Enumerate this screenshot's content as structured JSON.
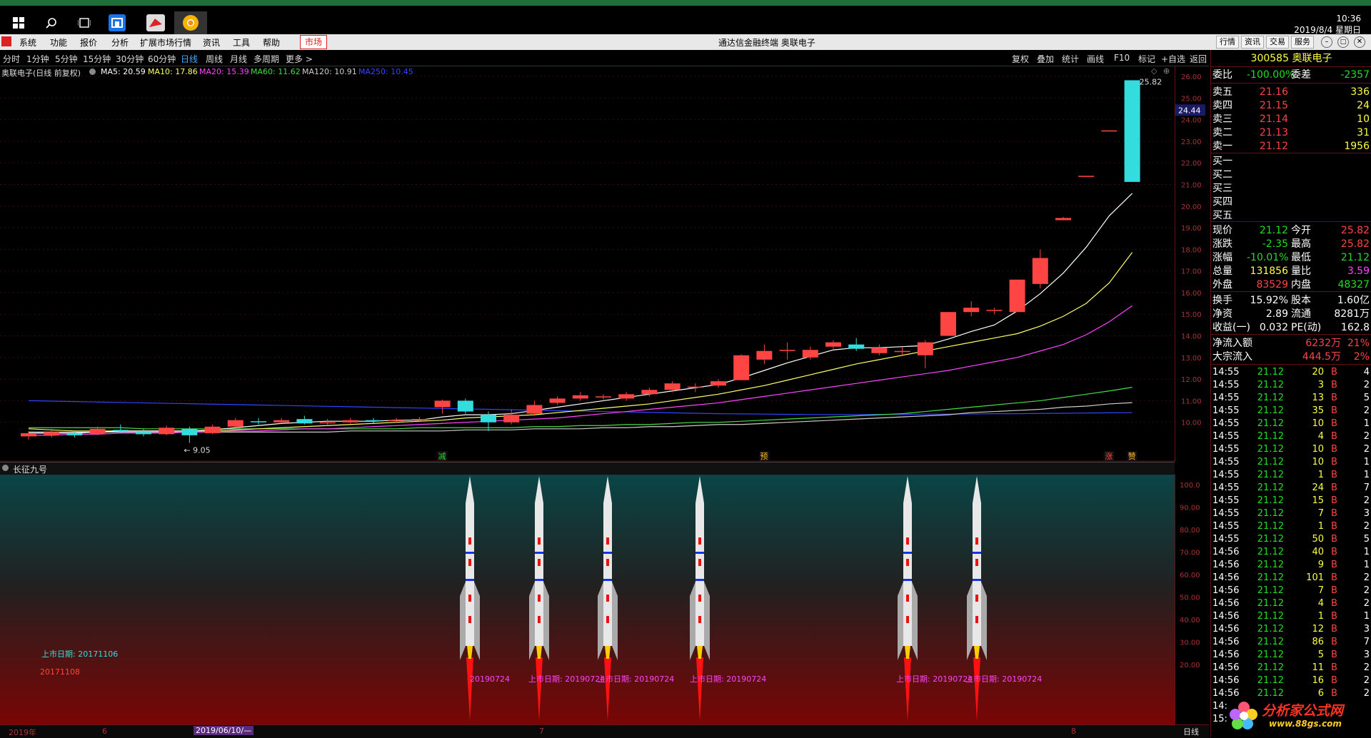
{
  "taskbar": {
    "time": "10:36",
    "date": "2019/8/4 星期日"
  },
  "window": {
    "title": "通达信金融终端 奥联电子",
    "menu": [
      "系统",
      "功能",
      "报价",
      "分析",
      "扩展市场行情",
      "资讯",
      "工具",
      "帮助"
    ],
    "market_tab": "市场",
    "right_buttons": [
      "行情",
      "资讯",
      "交易",
      "服务"
    ]
  },
  "toolbar": {
    "periods": [
      "分时",
      "1分钟",
      "5分钟",
      "15分钟",
      "30分钟",
      "60分钟",
      "日线",
      "周线",
      "月线",
      "多周期",
      "更多 >"
    ],
    "active_period": "日线",
    "tools": [
      "复权",
      "叠加",
      "统计",
      "画线",
      "F10",
      "标记",
      "+自选",
      "返回"
    ]
  },
  "chart_header": {
    "name": "奥联电子(日线 前复权)",
    "ma5": "MA5: 20.59",
    "ma10": "MA10: 17.86",
    "ma20": "MA20: 15.39",
    "ma60": "MA60: 11.62",
    "ma120": "MA120: 10.91",
    "ma250": "MA250: 10.45"
  },
  "colors": {
    "up": "#ff4444",
    "down": "#33dddd",
    "ma5": "#ffffff",
    "ma10": "#ffff66",
    "ma20": "#ff44ff",
    "ma60": "#44dd44",
    "ma120": "#cccccc",
    "ma250": "#3344ff"
  },
  "main_axis_labels": [
    "26.00",
    "25.00",
    "24.00",
    "23.00",
    "22.00",
    "21.00",
    "20.00",
    "19.00",
    "18.00",
    "17.00",
    "16.00",
    "15.00",
    "14.00",
    "13.00",
    "12.00",
    "11.00",
    "10.00"
  ],
  "price_marker": "24.44",
  "annotations": {
    "low_label": "9.05",
    "high_label": "25.82",
    "signals": [
      "减",
      "预",
      "涨",
      "赞"
    ]
  },
  "indicator": {
    "name": "长征九号",
    "axis_labels": [
      "100.0",
      "90.00",
      "80.00",
      "70.00",
      "60.00",
      "50.00",
      "40.00",
      "30.00",
      "20.00"
    ],
    "listing_label": "上市日期: 20171106",
    "listing_date": "20171108",
    "rocket_labels": [
      "20190724",
      "上市日期: 20190724",
      "上市日期: 20190724",
      "上市日期: 20190724",
      "上市日期: 20190724",
      "上市日期: 20190724"
    ]
  },
  "bottom_axis": {
    "year": "2019年",
    "m6": "6",
    "date_box": "2019/06/10/—",
    "m7": "7",
    "m8": "8",
    "period": "日线"
  },
  "chart_data": {
    "type": "candlestick",
    "title": "奥联电子(日线 前复权)",
    "ylim": [
      9,
      26
    ],
    "candles": [
      {
        "o": 9.35,
        "c": 9.5,
        "h": 9.6,
        "l": 9.2
      },
      {
        "o": 9.4,
        "c": 9.55,
        "h": 9.7,
        "l": 9.3
      },
      {
        "o": 9.5,
        "c": 9.4,
        "h": 9.6,
        "l": 9.3
      },
      {
        "o": 9.45,
        "c": 9.7,
        "h": 9.8,
        "l": 9.4
      },
      {
        "o": 9.65,
        "c": 9.6,
        "h": 9.9,
        "l": 9.5
      },
      {
        "o": 9.55,
        "c": 9.45,
        "h": 9.7,
        "l": 9.35
      },
      {
        "o": 9.45,
        "c": 9.75,
        "h": 9.85,
        "l": 9.4
      },
      {
        "o": 9.7,
        "c": 9.4,
        "h": 9.8,
        "l": 9.05
      },
      {
        "o": 9.5,
        "c": 9.8,
        "h": 9.9,
        "l": 9.45
      },
      {
        "o": 9.8,
        "c": 10.1,
        "h": 10.2,
        "l": 9.75
      },
      {
        "o": 10.05,
        "c": 10.0,
        "h": 10.2,
        "l": 9.9
      },
      {
        "o": 10.0,
        "c": 10.1,
        "h": 10.2,
        "l": 9.95
      },
      {
        "o": 10.15,
        "c": 9.95,
        "h": 10.3,
        "l": 9.9
      },
      {
        "o": 10.0,
        "c": 10.0,
        "h": 10.15,
        "l": 9.9
      },
      {
        "o": 10.0,
        "c": 10.1,
        "h": 10.2,
        "l": 9.95
      },
      {
        "o": 10.1,
        "c": 10.05,
        "h": 10.2,
        "l": 9.95
      },
      {
        "o": 10.05,
        "c": 10.1,
        "h": 10.2,
        "l": 10.0
      },
      {
        "o": 10.1,
        "c": 10.15,
        "h": 10.25,
        "l": 10.05
      },
      {
        "o": 10.7,
        "c": 11.0,
        "h": 11.05,
        "l": 10.4
      },
      {
        "o": 11.0,
        "c": 10.5,
        "h": 11.1,
        "l": 10.4
      },
      {
        "o": 10.35,
        "c": 10.0,
        "h": 10.5,
        "l": 9.6
      },
      {
        "o": 10.0,
        "c": 10.35,
        "h": 10.6,
        "l": 9.9
      },
      {
        "o": 10.4,
        "c": 10.8,
        "h": 11.0,
        "l": 10.3
      },
      {
        "o": 10.9,
        "c": 11.1,
        "h": 11.2,
        "l": 10.8
      },
      {
        "o": 11.1,
        "c": 11.25,
        "h": 11.4,
        "l": 11.0
      },
      {
        "o": 11.2,
        "c": 11.2,
        "h": 11.3,
        "l": 11.05
      },
      {
        "o": 11.1,
        "c": 11.3,
        "h": 11.4,
        "l": 11.0
      },
      {
        "o": 11.3,
        "c": 11.5,
        "h": 11.6,
        "l": 11.2
      },
      {
        "o": 11.5,
        "c": 11.8,
        "h": 11.9,
        "l": 11.4
      },
      {
        "o": 11.65,
        "c": 11.65,
        "h": 11.8,
        "l": 11.4
      },
      {
        "o": 11.7,
        "c": 11.9,
        "h": 12.0,
        "l": 11.6
      },
      {
        "o": 11.95,
        "c": 13.1,
        "h": 13.15,
        "l": 11.95
      },
      {
        "o": 12.9,
        "c": 13.3,
        "h": 13.6,
        "l": 12.7
      },
      {
        "o": 13.3,
        "c": 13.35,
        "h": 13.7,
        "l": 12.9
      },
      {
        "o": 13.0,
        "c": 13.35,
        "h": 13.5,
        "l": 12.9
      },
      {
        "o": 13.5,
        "c": 13.7,
        "h": 13.8,
        "l": 13.4
      },
      {
        "o": 13.6,
        "c": 13.4,
        "h": 13.9,
        "l": 13.3
      },
      {
        "o": 13.2,
        "c": 13.45,
        "h": 13.6,
        "l": 13.1
      },
      {
        "o": 13.3,
        "c": 13.3,
        "h": 13.5,
        "l": 13.1
      },
      {
        "o": 13.1,
        "c": 13.7,
        "h": 13.8,
        "l": 12.5
      },
      {
        "o": 14.0,
        "c": 15.1,
        "h": 15.1,
        "l": 14.0
      },
      {
        "o": 15.1,
        "c": 15.3,
        "h": 15.6,
        "l": 14.9
      },
      {
        "o": 15.2,
        "c": 15.2,
        "h": 15.3,
        "l": 15.0
      },
      {
        "o": 15.1,
        "c": 16.6,
        "h": 16.6,
        "l": 15.1
      },
      {
        "o": 16.4,
        "c": 17.6,
        "h": 18.0,
        "l": 16.2
      },
      {
        "o": 19.35,
        "c": 19.45,
        "h": 19.5,
        "l": 19.35
      },
      {
        "o": 21.4,
        "c": 21.4,
        "h": 21.4,
        "l": 21.4
      },
      {
        "o": 23.5,
        "c": 23.5,
        "h": 23.5,
        "l": 23.5
      },
      {
        "o": 25.82,
        "c": 21.12,
        "h": 25.82,
        "l": 21.12
      }
    ],
    "ma5": [
      9.5,
      9.5,
      9.5,
      9.55,
      9.6,
      9.6,
      9.6,
      9.6,
      9.65,
      9.75,
      9.85,
      9.95,
      10.0,
      10.05,
      10.05,
      10.05,
      10.1,
      10.1,
      10.25,
      10.35,
      10.35,
      10.4,
      10.55,
      10.7,
      10.85,
      11.0,
      11.15,
      11.3,
      11.45,
      11.6,
      11.75,
      12.05,
      12.4,
      12.75,
      13.05,
      13.35,
      13.45,
      13.45,
      13.5,
      13.55,
      13.85,
      14.2,
      14.5,
      15.15,
      15.95,
      16.9,
      18.1,
      19.55,
      20.59
    ],
    "ma10": [
      9.7,
      9.65,
      9.6,
      9.6,
      9.6,
      9.6,
      9.6,
      9.6,
      9.6,
      9.65,
      9.7,
      9.75,
      9.8,
      9.85,
      9.9,
      9.95,
      10.0,
      10.05,
      10.1,
      10.2,
      10.25,
      10.3,
      10.35,
      10.45,
      10.55,
      10.65,
      10.75,
      10.85,
      11.0,
      11.15,
      11.3,
      11.5,
      11.7,
      11.95,
      12.2,
      12.45,
      12.7,
      12.9,
      13.1,
      13.3,
      13.5,
      13.7,
      13.9,
      14.1,
      14.45,
      14.9,
      15.5,
      16.45,
      17.86
    ],
    "ma20": [
      9.4,
      9.4,
      9.45,
      9.45,
      9.5,
      9.5,
      9.5,
      9.55,
      9.55,
      9.6,
      9.6,
      9.65,
      9.7,
      9.7,
      9.75,
      9.8,
      9.85,
      9.9,
      9.95,
      10.0,
      10.05,
      10.1,
      10.15,
      10.2,
      10.3,
      10.4,
      10.5,
      10.6,
      10.7,
      10.8,
      10.9,
      11.05,
      11.2,
      11.35,
      11.5,
      11.65,
      11.8,
      11.95,
      12.1,
      12.25,
      12.4,
      12.6,
      12.8,
      13.0,
      13.3,
      13.6,
      14.05,
      14.65,
      15.39
    ],
    "ma60": [
      9.75,
      9.75,
      9.75,
      9.75,
      9.75,
      9.7,
      9.7,
      9.7,
      9.7,
      9.7,
      9.7,
      9.7,
      9.7,
      9.7,
      9.7,
      9.7,
      9.7,
      9.75,
      9.75,
      9.75,
      9.75,
      9.75,
      9.8,
      9.8,
      9.85,
      9.85,
      9.9,
      9.9,
      9.95,
      10.0,
      10.0,
      10.05,
      10.1,
      10.15,
      10.2,
      10.25,
      10.3,
      10.35,
      10.4,
      10.5,
      10.6,
      10.7,
      10.8,
      10.9,
      11.0,
      11.15,
      11.3,
      11.45,
      11.62
    ],
    "ma120": [
      9.55,
      9.55,
      9.55,
      9.55,
      9.55,
      9.55,
      9.55,
      9.55,
      9.55,
      9.55,
      9.55,
      9.55,
      9.55,
      9.55,
      9.6,
      9.6,
      9.6,
      9.6,
      9.6,
      9.65,
      9.65,
      9.65,
      9.7,
      9.7,
      9.7,
      9.75,
      9.75,
      9.8,
      9.8,
      9.85,
      9.9,
      9.9,
      9.95,
      10.0,
      10.05,
      10.1,
      10.15,
      10.2,
      10.25,
      10.3,
      10.35,
      10.45,
      10.5,
      10.55,
      10.6,
      10.7,
      10.75,
      10.85,
      10.91
    ],
    "ma250": [
      11.0,
      10.98,
      10.96,
      10.94,
      10.92,
      10.9,
      10.88,
      10.86,
      10.84,
      10.82,
      10.8,
      10.78,
      10.76,
      10.74,
      10.72,
      10.7,
      10.68,
      10.66,
      10.64,
      10.62,
      10.6,
      10.58,
      10.56,
      10.54,
      10.52,
      10.5,
      10.48,
      10.46,
      10.44,
      10.42,
      10.4,
      10.39,
      10.38,
      10.37,
      10.36,
      10.36,
      10.36,
      10.37,
      10.37,
      10.38,
      10.38,
      10.39,
      10.4,
      10.4,
      10.41,
      10.42,
      10.43,
      10.44,
      10.45
    ],
    "rocket_candle_index": [
      20,
      23,
      26,
      30,
      39,
      42
    ]
  },
  "quote": {
    "code_name": "300585 奥联电子",
    "weibi_label": "委比",
    "weibi": "-100.00%",
    "weicha_label": "委差",
    "weicha": "-2357",
    "sells": [
      {
        "label": "卖五",
        "price": "21.16",
        "vol": "336"
      },
      {
        "label": "卖四",
        "price": "21.15",
        "vol": "24"
      },
      {
        "label": "卖三",
        "price": "21.14",
        "vol": "10"
      },
      {
        "label": "卖二",
        "price": "21.13",
        "vol": "31"
      },
      {
        "label": "卖一",
        "price": "21.12",
        "vol": "1956"
      }
    ],
    "buys": [
      "买一",
      "买二",
      "买三",
      "买四",
      "买五"
    ],
    "stats": [
      {
        "l1": "现价",
        "v1": "21.12",
        "l2": "今开",
        "v2": "25.82",
        "c1": "grn",
        "c2": "red"
      },
      {
        "l1": "涨跌",
        "v1": "-2.35",
        "l2": "最高",
        "v2": "25.82",
        "c1": "grn",
        "c2": "red"
      },
      {
        "l1": "涨幅",
        "v1": "-10.01%",
        "l2": "最低",
        "v2": "21.12",
        "c1": "grn",
        "c2": "grn"
      },
      {
        "l1": "总量",
        "v1": "131856",
        "l2": "量比",
        "v2": "3.59",
        "c1": "yel",
        "c2": "mag"
      },
      {
        "l1": "外盘",
        "v1": "83529",
        "l2": "内盘",
        "v2": "48327",
        "c1": "red",
        "c2": "grn"
      }
    ],
    "stats2": [
      {
        "l1": "换手",
        "v1": "15.92%",
        "l2": "股本",
        "v2": "1.60亿"
      },
      {
        "l1": "净资",
        "v1": "2.89",
        "l2": "流通",
        "v2": "8281万"
      },
      {
        "l1": "收益(一)",
        "v1": "0.032",
        "l2": "PE(动)",
        "v2": "162.8"
      }
    ],
    "flows": [
      {
        "label": "净流入额",
        "value": "6232万",
        "pct": "21%"
      },
      {
        "label": "大宗流入",
        "value": "444.5万",
        "pct": "2%"
      }
    ],
    "ticks": [
      [
        "14:55",
        "21.12",
        "20",
        "B",
        "4"
      ],
      [
        "14:55",
        "21.12",
        "3",
        "B",
        "2"
      ],
      [
        "14:55",
        "21.12",
        "13",
        "B",
        "5"
      ],
      [
        "14:55",
        "21.12",
        "35",
        "B",
        "2"
      ],
      [
        "14:55",
        "21.12",
        "10",
        "B",
        "1"
      ],
      [
        "14:55",
        "21.12",
        "4",
        "B",
        "2"
      ],
      [
        "14:55",
        "21.12",
        "10",
        "B",
        "2"
      ],
      [
        "14:55",
        "21.12",
        "10",
        "B",
        "1"
      ],
      [
        "14:55",
        "21.12",
        "1",
        "B",
        "1"
      ],
      [
        "14:55",
        "21.12",
        "24",
        "B",
        "7"
      ],
      [
        "14:55",
        "21.12",
        "15",
        "B",
        "2"
      ],
      [
        "14:55",
        "21.12",
        "7",
        "B",
        "3"
      ],
      [
        "14:55",
        "21.12",
        "1",
        "B",
        "2"
      ],
      [
        "14:55",
        "21.12",
        "50",
        "B",
        "5"
      ],
      [
        "14:56",
        "21.12",
        "40",
        "B",
        "1"
      ],
      [
        "14:56",
        "21.12",
        "9",
        "B",
        "1"
      ],
      [
        "14:56",
        "21.12",
        "101",
        "B",
        "2"
      ],
      [
        "14:56",
        "21.12",
        "7",
        "B",
        "2"
      ],
      [
        "14:56",
        "21.12",
        "4",
        "B",
        "2"
      ],
      [
        "14:56",
        "21.12",
        "1",
        "B",
        "1"
      ],
      [
        "14:56",
        "21.12",
        "12",
        "B",
        "3"
      ],
      [
        "14:56",
        "21.12",
        "86",
        "B",
        "7"
      ],
      [
        "14:56",
        "21.12",
        "5",
        "B",
        "3"
      ],
      [
        "14:56",
        "21.12",
        "11",
        "B",
        "2"
      ],
      [
        "14:56",
        "21.12",
        "16",
        "B",
        "2"
      ],
      [
        "14:56",
        "21.12",
        "6",
        "B",
        "2"
      ],
      [
        "14:",
        "",
        "",
        "",
        ""
      ],
      [
        "15:",
        "",
        "",
        "",
        ""
      ]
    ]
  },
  "watermark": {
    "text": "分析家公式网",
    "url": "www.88gs.com"
  }
}
